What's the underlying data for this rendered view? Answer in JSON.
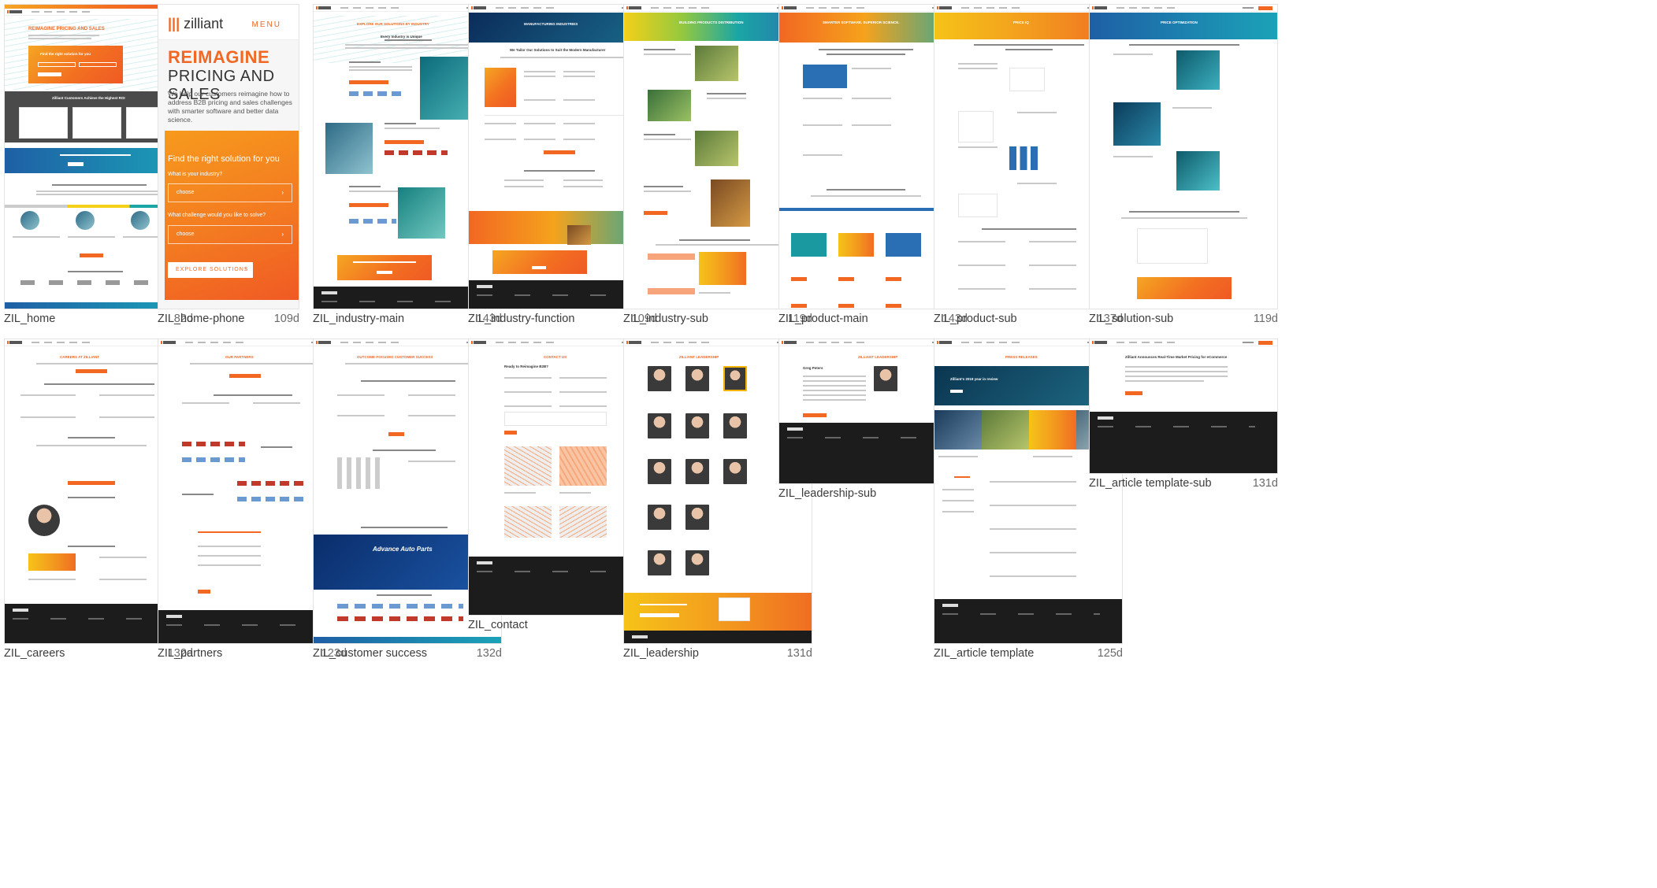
{
  "thumbnails": [
    {
      "name": "ZIL_home",
      "age": "82d"
    },
    {
      "name": "ZIL_home-phone",
      "age": "109d"
    },
    {
      "name": "ZIL_industry-main",
      "age": "143d"
    },
    {
      "name": "ZIL_industry-function",
      "age": "109d"
    },
    {
      "name": "ZIL_industry-sub",
      "age": "119d"
    },
    {
      "name": "ZIL_product-main",
      "age": "143d"
    },
    {
      "name": "ZIL_product-sub",
      "age": "137d"
    },
    {
      "name": "ZIL_solution-sub",
      "age": "119d"
    },
    {
      "name": "ZIL_careers",
      "age": "132d"
    },
    {
      "name": "ZIL_partners",
      "age": "123d"
    },
    {
      "name": "ZIL_customer success",
      "age": "132d"
    },
    {
      "name": "ZIL_contact",
      "age": "132d"
    },
    {
      "name": "ZIL_leadership",
      "age": "131d"
    },
    {
      "name": "ZIL_leadership-sub",
      "age": "131d"
    },
    {
      "name": "ZIL_article template",
      "age": "125d"
    },
    {
      "name": "ZIL_article template-sub",
      "age": "131d"
    }
  ],
  "phone": {
    "logo": "zilliant",
    "menu": "MENU",
    "title_line1": "REIMAGINE",
    "title_line2": "PRICING AND SALES",
    "body": "We help our customers reimagine how to address B2B pricing and sales challenges with smarter software and better data science.",
    "find": "Find the right solution for you",
    "q1": "What is your industry?",
    "q2": "What challenge would you like to solve?",
    "choose": "choose",
    "explore": "EXPLORE SOLUTIONS"
  },
  "mini": {
    "home_hero": "REIMAGINE PRICING AND SALES",
    "home_find": "Find the right solution for you",
    "home_customers": "Zilliant Customers Achieve the Highest ROI",
    "home_improve": "Improve Revenue and Margin Performance",
    "home_who": "Who We've Helped Succeed",
    "ind_main": "EXPLORE OUR SOLUTIONS BY INDUSTRY",
    "ind_unique": "Every Industry is Unique",
    "ind_func": "MANUFACTURING INDUSTRIES",
    "ind_tailor": "We Tailor Our Solutions to Suit the Modern Manufacturer",
    "ind_sub": "BUILDING PRODUCTS DISTRIBUTION",
    "prod_main": "SMARTER SOFTWARE. SUPERIOR SCIENCE.",
    "prod_sub": "PRICE IQ",
    "sol_sub": "PRICE OPTIMIZATION",
    "careers": "CAREERS AT ZILLIANT",
    "partners": "OUR PARTNERS",
    "cust": "OUTCOME-FOCUSED CUSTOMER SUCCESS",
    "cust_advance": "Advance Auto Parts",
    "contact": "CONTACT US",
    "contact_ready": "Ready to Reimagine B2B?",
    "lead": "ZILLIANT LEADERSHIP",
    "lead_sub_name": "Greg Peters",
    "article": "PRESS RELEASES",
    "article_review": "Zilliant's 2019 year in review",
    "article_sub": "Zilliant Announces Real-Time Market Pricing for eCommerce"
  }
}
